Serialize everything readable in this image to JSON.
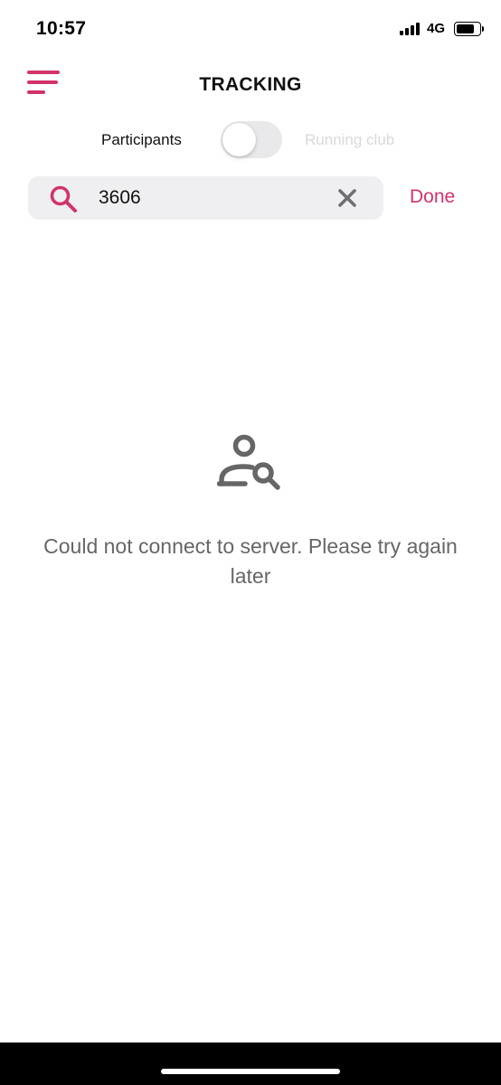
{
  "status_bar": {
    "time": "10:57",
    "network": "4G",
    "battery_level": 0.85
  },
  "header": {
    "title": "TRACKING",
    "menu_icon": "hamburger-menu-icon"
  },
  "toggle": {
    "left_label": "Participants",
    "right_label": "Running club",
    "state": "off"
  },
  "search": {
    "value": "3606",
    "search_icon": "search-icon",
    "clear_icon": "close-icon",
    "done_label": "Done"
  },
  "empty_state": {
    "icon": "person-search-icon",
    "message": "Could not connect to server. Please try again later"
  },
  "colors": {
    "accent": "#d2336d",
    "muted_text": "#666666",
    "disabled_text": "#d9d9d9",
    "search_bg": "#efeff1"
  }
}
